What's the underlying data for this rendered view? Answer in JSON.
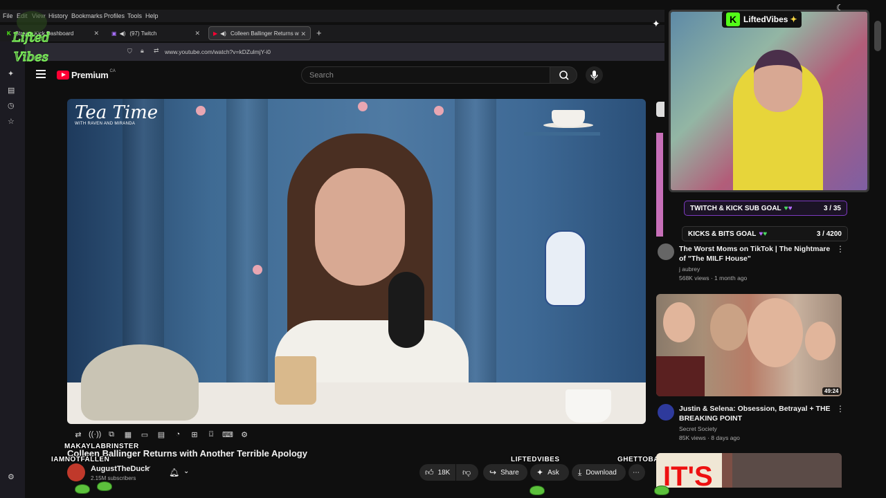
{
  "browser": {
    "menu": [
      "File",
      "Edit",
      "View",
      "History",
      "Bookmarks",
      "Profiles",
      "Tools",
      "Help"
    ],
    "tabs": [
      {
        "label": "Stream Kick Dashboard"
      },
      {
        "label": "(97) Twitch"
      },
      {
        "label": "Colleen Ballinger Returns w"
      }
    ],
    "url": "www.youtube.com/watch?v=kDZulmjY-i0"
  },
  "youtube": {
    "logo_text": "Premium",
    "country": "CA",
    "search_placeholder": "Search"
  },
  "video": {
    "show_logo": "Tea Time",
    "show_logo_sub": "WITH RAVEN AND MIRANDA",
    "title": "Colleen Ballinger Returns with Another Terrible Apology",
    "channel": "AugustTheDuck",
    "subscribers": "2.15M subscribers",
    "likes": "18K",
    "share_label": "Share",
    "ask_label": "Ask",
    "download_label": "Download"
  },
  "overlay": {
    "names": [
      "MAKAYLABRINSTER",
      "IAMNOTFALLEN",
      "LIFTEDVIBES",
      "GHETTOBANDITSJAY"
    ],
    "logo_text": "Lifted Vibes",
    "cam_badge": "LiftedVibes",
    "goals": [
      {
        "label": "TWITCH & KICK SUB GOAL",
        "count": "3 / 35"
      },
      {
        "label": "KICKS & BITS GOAL",
        "count": "3 / 4200"
      }
    ]
  },
  "recommendations": [
    {
      "title": "The Worst Moms on TikTok | The Nightmare of \"The MILF House\"",
      "channel": "j aubrey",
      "meta": "568K views · 1 month ago"
    },
    {
      "title": "Justin & Selena: Obsession, Betrayal + THE BREAKING POINT",
      "channel": "Secret Society",
      "meta": "85K views · 8 days ago",
      "duration": "49:24"
    },
    {
      "thumb_text": "IT'S"
    }
  ],
  "colors": {
    "yt_red": "#ff0033",
    "kick_green": "#53fc18",
    "goal_border": "#7d3ac1"
  }
}
